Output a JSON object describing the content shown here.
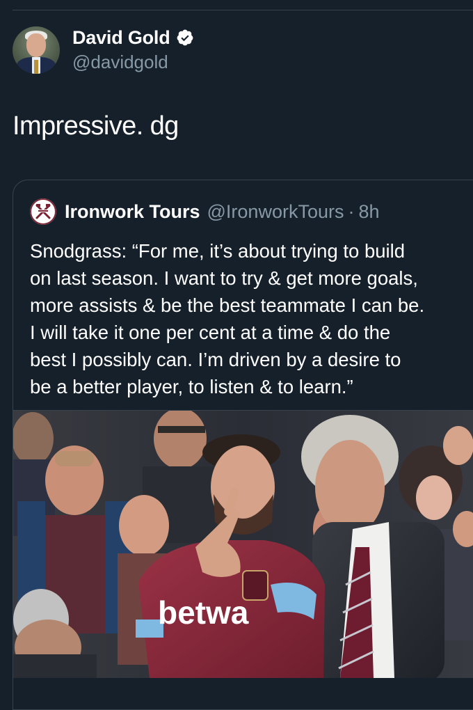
{
  "tweet": {
    "author": {
      "display_name": "David Gold",
      "handle": "@davidgold",
      "verified": true
    },
    "text": "Impressive. dg"
  },
  "quoted_tweet": {
    "author": {
      "display_name": "Ironwork Tours",
      "handle": "@IronworkTours",
      "separator": "·",
      "time": "8h"
    },
    "text_lines": [
      "Snodgrass: “For me, it’s about trying to build",
      "on last season. I want to try & get more goals,",
      "more assists & be the best teammate I can be.",
      "I will take it one per cent at a time & do the",
      "best I possibly can. I’m driven by a desire to",
      "be a better player, to listen & to learn.”"
    ],
    "image": {
      "shirt_sponsor": "betwa"
    }
  },
  "colors": {
    "background": "#15202b",
    "border": "#38444d",
    "secondary_text": "#8899a6",
    "verified_badge": "#ffffff",
    "shirt_claret": "#8e2a3c",
    "shirt_sleeve_blue": "#7fb8e0"
  },
  "icons": {
    "verified": "verified-badge-icon",
    "quote_avatar": "ironwork-crest-icon"
  }
}
